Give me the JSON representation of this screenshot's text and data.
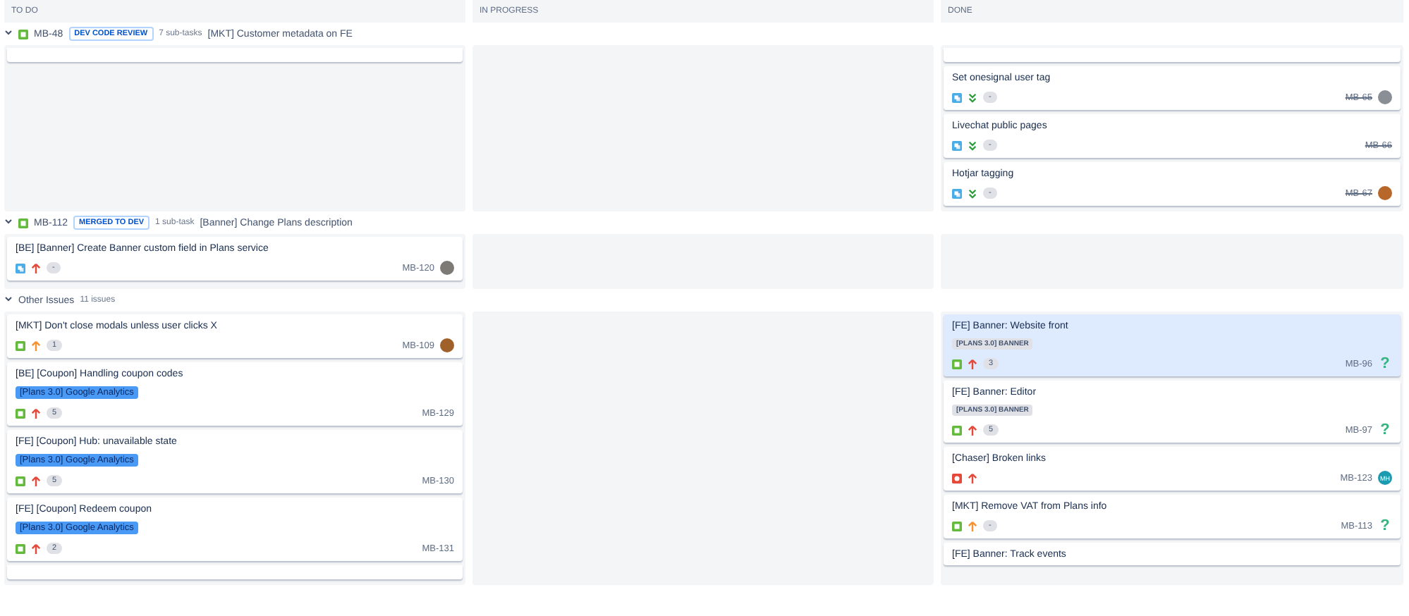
{
  "columns": [
    {
      "title": "TO DO"
    },
    {
      "title": "IN PROGRESS"
    },
    {
      "title": "DONE"
    }
  ],
  "lanes": [
    {
      "kind": "issue",
      "expanded": true,
      "key": "MB-48",
      "status": "DEV CODE REVIEW",
      "subtasks": "7 sub-tasks",
      "title": "[MKT] Customer metadata on FE",
      "cells": [
        [
          {
            "kind": "fragment"
          }
        ],
        [],
        [
          {
            "kind": "fragment"
          },
          {
            "kind": "card",
            "title": "Set onesignal user tag",
            "issue_type": {
              "kind": "subtask"
            },
            "priority": {
              "kind": "lowest"
            },
            "estimate": "-",
            "key": "MB-65",
            "done": true,
            "assignee": {
              "kind": "photo",
              "color": "#8a8f96"
            },
            "selected": false
          },
          {
            "kind": "card",
            "title": "Livechat public pages",
            "issue_type": {
              "kind": "subtask"
            },
            "priority": {
              "kind": "lowest"
            },
            "estimate": "-",
            "key": "MB-66",
            "done": true,
            "selected": false
          },
          {
            "kind": "card",
            "title": "Hotjar tagging",
            "issue_type": {
              "kind": "subtask"
            },
            "priority": {
              "kind": "lowest"
            },
            "estimate": "-",
            "key": "MB-67",
            "done": true,
            "assignee": {
              "kind": "photo",
              "color": "#b8672a"
            },
            "selected": false
          }
        ]
      ]
    },
    {
      "kind": "issue",
      "expanded": true,
      "key": "MB-112",
      "status": "MERGED TO DEV",
      "subtasks": "1 sub-task",
      "title": "[Banner] Change Plans description",
      "cells": [
        [
          {
            "kind": "card",
            "title": "[BE] [Banner] Create Banner custom field in Plans service",
            "issue_type": {
              "kind": "subtask"
            },
            "priority": {
              "kind": "high"
            },
            "estimate": "-",
            "key": "MB-120",
            "done": false,
            "assignee": {
              "kind": "photo",
              "color": "#7d7a76"
            },
            "selected": false
          }
        ],
        [],
        []
      ]
    },
    {
      "kind": "other",
      "expanded": true,
      "title": "Other Issues",
      "count": "11 issues",
      "cells": [
        [
          {
            "kind": "card",
            "title": "[MKT] Don't close modals unless user clicks X",
            "issue_type": {
              "kind": "story"
            },
            "priority": {
              "kind": "medium"
            },
            "estimate": "1",
            "key": "MB-109",
            "done": false,
            "assignee": {
              "kind": "photo",
              "color": "#a0602a"
            },
            "selected": false
          },
          {
            "kind": "card",
            "title": "[BE] [Coupon] Handling coupon codes",
            "epic": "[Plans 3.0] Google Analytics",
            "issue_type": {
              "kind": "story"
            },
            "priority": {
              "kind": "high"
            },
            "estimate": "5",
            "key": "MB-129",
            "done": false,
            "selected": false
          },
          {
            "kind": "card",
            "title": "[FE] [Coupon] Hub: unavailable state",
            "epic": "[Plans 3.0] Google Analytics",
            "issue_type": {
              "kind": "story"
            },
            "priority": {
              "kind": "high"
            },
            "estimate": "5",
            "key": "MB-130",
            "done": false,
            "selected": false
          },
          {
            "kind": "card",
            "title": "[FE] [Coupon] Redeem coupon",
            "epic": "[Plans 3.0] Google Analytics",
            "issue_type": {
              "kind": "story"
            },
            "priority": {
              "kind": "high"
            },
            "estimate": "2",
            "key": "MB-131",
            "done": false,
            "selected": false
          },
          {
            "kind": "fragment"
          }
        ],
        [],
        [
          {
            "kind": "card",
            "title": "[FE] Banner: Website front",
            "label": "[PLANS 3.0] BANNER",
            "issue_type": {
              "kind": "story"
            },
            "priority": {
              "kind": "high"
            },
            "estimate": "3",
            "key": "MB-96",
            "done": false,
            "assignee": {
              "kind": "unknown",
              "text": "?"
            },
            "selected": true
          },
          {
            "kind": "card",
            "title": "[FE] Banner: Editor",
            "label": "[PLANS 3.0] BANNER",
            "issue_type": {
              "kind": "story"
            },
            "priority": {
              "kind": "high"
            },
            "estimate": "5",
            "key": "MB-97",
            "done": false,
            "assignee": {
              "kind": "unknown",
              "text": "?"
            },
            "selected": false
          },
          {
            "kind": "card",
            "title": "[Chaser] Broken links",
            "issue_type": {
              "kind": "bug"
            },
            "priority": {
              "kind": "high"
            },
            "key": "MB-123",
            "done": false,
            "assignee": {
              "kind": "initials",
              "text": "MH",
              "color": "#1a9bb0"
            },
            "selected": false
          },
          {
            "kind": "card",
            "title": "[MKT] Remove VAT from Plans info",
            "issue_type": {
              "kind": "story"
            },
            "priority": {
              "kind": "medium"
            },
            "estimate": "-",
            "key": "MB-113",
            "done": false,
            "assignee": {
              "kind": "unknown",
              "text": "?"
            },
            "selected": false
          },
          {
            "kind": "card",
            "title": "[FE] Banner: Track events",
            "selected": false
          }
        ]
      ]
    }
  ]
}
